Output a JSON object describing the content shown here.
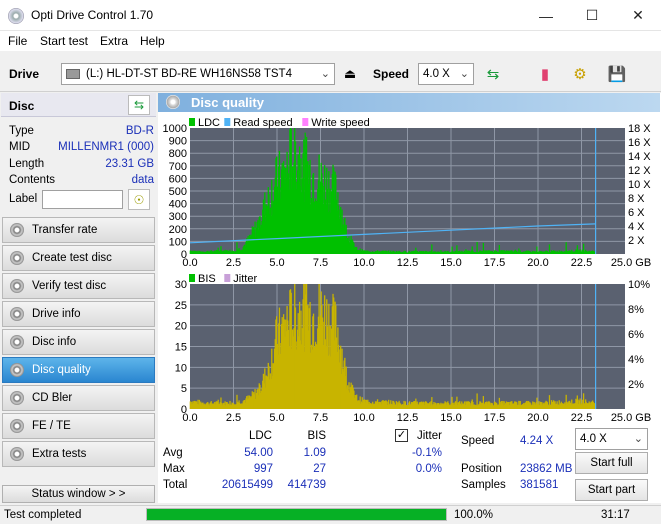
{
  "window": {
    "title": "Opti Drive Control 1.70",
    "minimize": "—",
    "maximize": "☐",
    "close": "✕"
  },
  "menu": [
    "File",
    "Start test",
    "Extra",
    "Help"
  ],
  "toolbar": {
    "drive_label": "Drive",
    "drive_value": "(L:)  HL-DT-ST BD-RE  WH16NS58 TST4",
    "speed_label": "Speed",
    "speed_value": "4.0 X"
  },
  "disc": {
    "header": "Disc",
    "rows": [
      {
        "label": "Type",
        "value": "BD-R"
      },
      {
        "label": "MID",
        "value": "MILLENMR1 (000)"
      },
      {
        "label": "Length",
        "value": "23.31 GB"
      },
      {
        "label": "Contents",
        "value": "data"
      },
      {
        "label": "Label",
        "value": ""
      }
    ]
  },
  "nav": [
    {
      "label": "Transfer rate",
      "active": false
    },
    {
      "label": "Create test disc",
      "active": false
    },
    {
      "label": "Verify test disc",
      "active": false
    },
    {
      "label": "Drive info",
      "active": false
    },
    {
      "label": "Disc info",
      "active": false
    },
    {
      "label": "Disc quality",
      "active": true
    },
    {
      "label": "CD Bler",
      "active": false
    },
    {
      "label": "FE / TE",
      "active": false
    },
    {
      "label": "Extra tests",
      "active": false
    }
  ],
  "status_window_button": "Status window > >",
  "panel_title": "Disc quality",
  "colors": {
    "ldc": "#00c000",
    "bis": "#c8b400",
    "read": "#4fb3f6",
    "write": "#ff80ff",
    "jitter": "#c8a0d8",
    "plot_bg": "#5a6170",
    "grid": "#8f97a6"
  },
  "chart_data": [
    {
      "type": "area",
      "legend": [
        "LDC",
        "Read speed",
        "Write speed"
      ],
      "x_ticks": [
        "0.0",
        "2.5",
        "5.0",
        "7.5",
        "10.0",
        "12.5",
        "15.0",
        "17.5",
        "20.0",
        "22.5",
        "25.0 GB"
      ],
      "y_left_ticks": [
        "1000",
        "900",
        "800",
        "700",
        "600",
        "500",
        "400",
        "300",
        "200",
        "100"
      ],
      "y_right_ticks": [
        "18 X",
        "16 X",
        "14 X",
        "12 X",
        "10 X",
        "8 X",
        "6 X",
        "4 X",
        "2 X"
      ],
      "xlim": [
        0,
        25
      ],
      "ylim": [
        0,
        1000
      ],
      "y2lim": [
        0,
        18
      ],
      "ldc": {
        "x": [
          0,
          0.5,
          1.5,
          2.5,
          3,
          3.5,
          4,
          4.5,
          5,
          5.5,
          6,
          6.5,
          7,
          7.5,
          8,
          8.5,
          9,
          9.5,
          10,
          12.5,
          15,
          17.5,
          20,
          22.5,
          23.31
        ],
        "y": [
          30,
          20,
          25,
          30,
          50,
          150,
          280,
          480,
          620,
          700,
          900,
          760,
          690,
          640,
          600,
          500,
          180,
          50,
          25,
          20,
          20,
          25,
          20,
          30,
          20
        ]
      },
      "read_speed": {
        "x": [
          0,
          5,
          10,
          15,
          20,
          23.31
        ],
        "y": [
          1.6,
          2.2,
          2.8,
          3.4,
          4.0,
          4.3
        ]
      }
    },
    {
      "type": "area",
      "legend": [
        "BIS",
        "Jitter"
      ],
      "x_ticks": [
        "0.0",
        "2.5",
        "5.0",
        "7.5",
        "10.0",
        "12.5",
        "15.0",
        "17.5",
        "20.0",
        "22.5",
        "25.0 GB"
      ],
      "y_left_ticks": [
        "30",
        "25",
        "20",
        "15",
        "10",
        "5"
      ],
      "y_right_ticks": [
        "10%",
        "8%",
        "6%",
        "4%",
        "2%"
      ],
      "xlim": [
        0,
        25
      ],
      "ylim": [
        0,
        30
      ],
      "y2lim": [
        0,
        10
      ],
      "bis": {
        "x": [
          0,
          1,
          2,
          3,
          3.5,
          4,
          4.5,
          5,
          5.5,
          6,
          6.5,
          7,
          7.5,
          8,
          8.5,
          9,
          9.5,
          10,
          12.5,
          15,
          17.5,
          20,
          22.5,
          23.31
        ],
        "y": [
          2,
          1.5,
          1.5,
          2,
          3,
          5,
          10,
          18,
          22,
          24,
          25,
          24,
          25,
          23,
          20,
          8,
          3,
          2,
          1.5,
          1.5,
          1.5,
          1.5,
          2,
          1.5
        ]
      }
    }
  ],
  "stats": {
    "col_ldc": "LDC",
    "col_bis": "BIS",
    "jitter_label": "Jitter",
    "jitter_checked": true,
    "rows": [
      {
        "label": "Avg",
        "ldc": "54.00",
        "bis": "1.09",
        "jitter": "-0.1%"
      },
      {
        "label": "Max",
        "ldc": "997",
        "bis": "27",
        "jitter": "0.0%"
      },
      {
        "label": "Total",
        "ldc": "20615499",
        "bis": "414739",
        "jitter": ""
      }
    ],
    "speed_label": "Speed",
    "speed_value": "4.24 X",
    "position_label": "Position",
    "position_value": "23862 MB",
    "samples_label": "Samples",
    "samples_value": "381581",
    "speed_select": "4.0 X",
    "start_full": "Start full",
    "start_part": "Start part"
  },
  "status": {
    "text": "Test completed",
    "progress": 100.0,
    "progress_text": "100.0%",
    "time": "31:17"
  }
}
